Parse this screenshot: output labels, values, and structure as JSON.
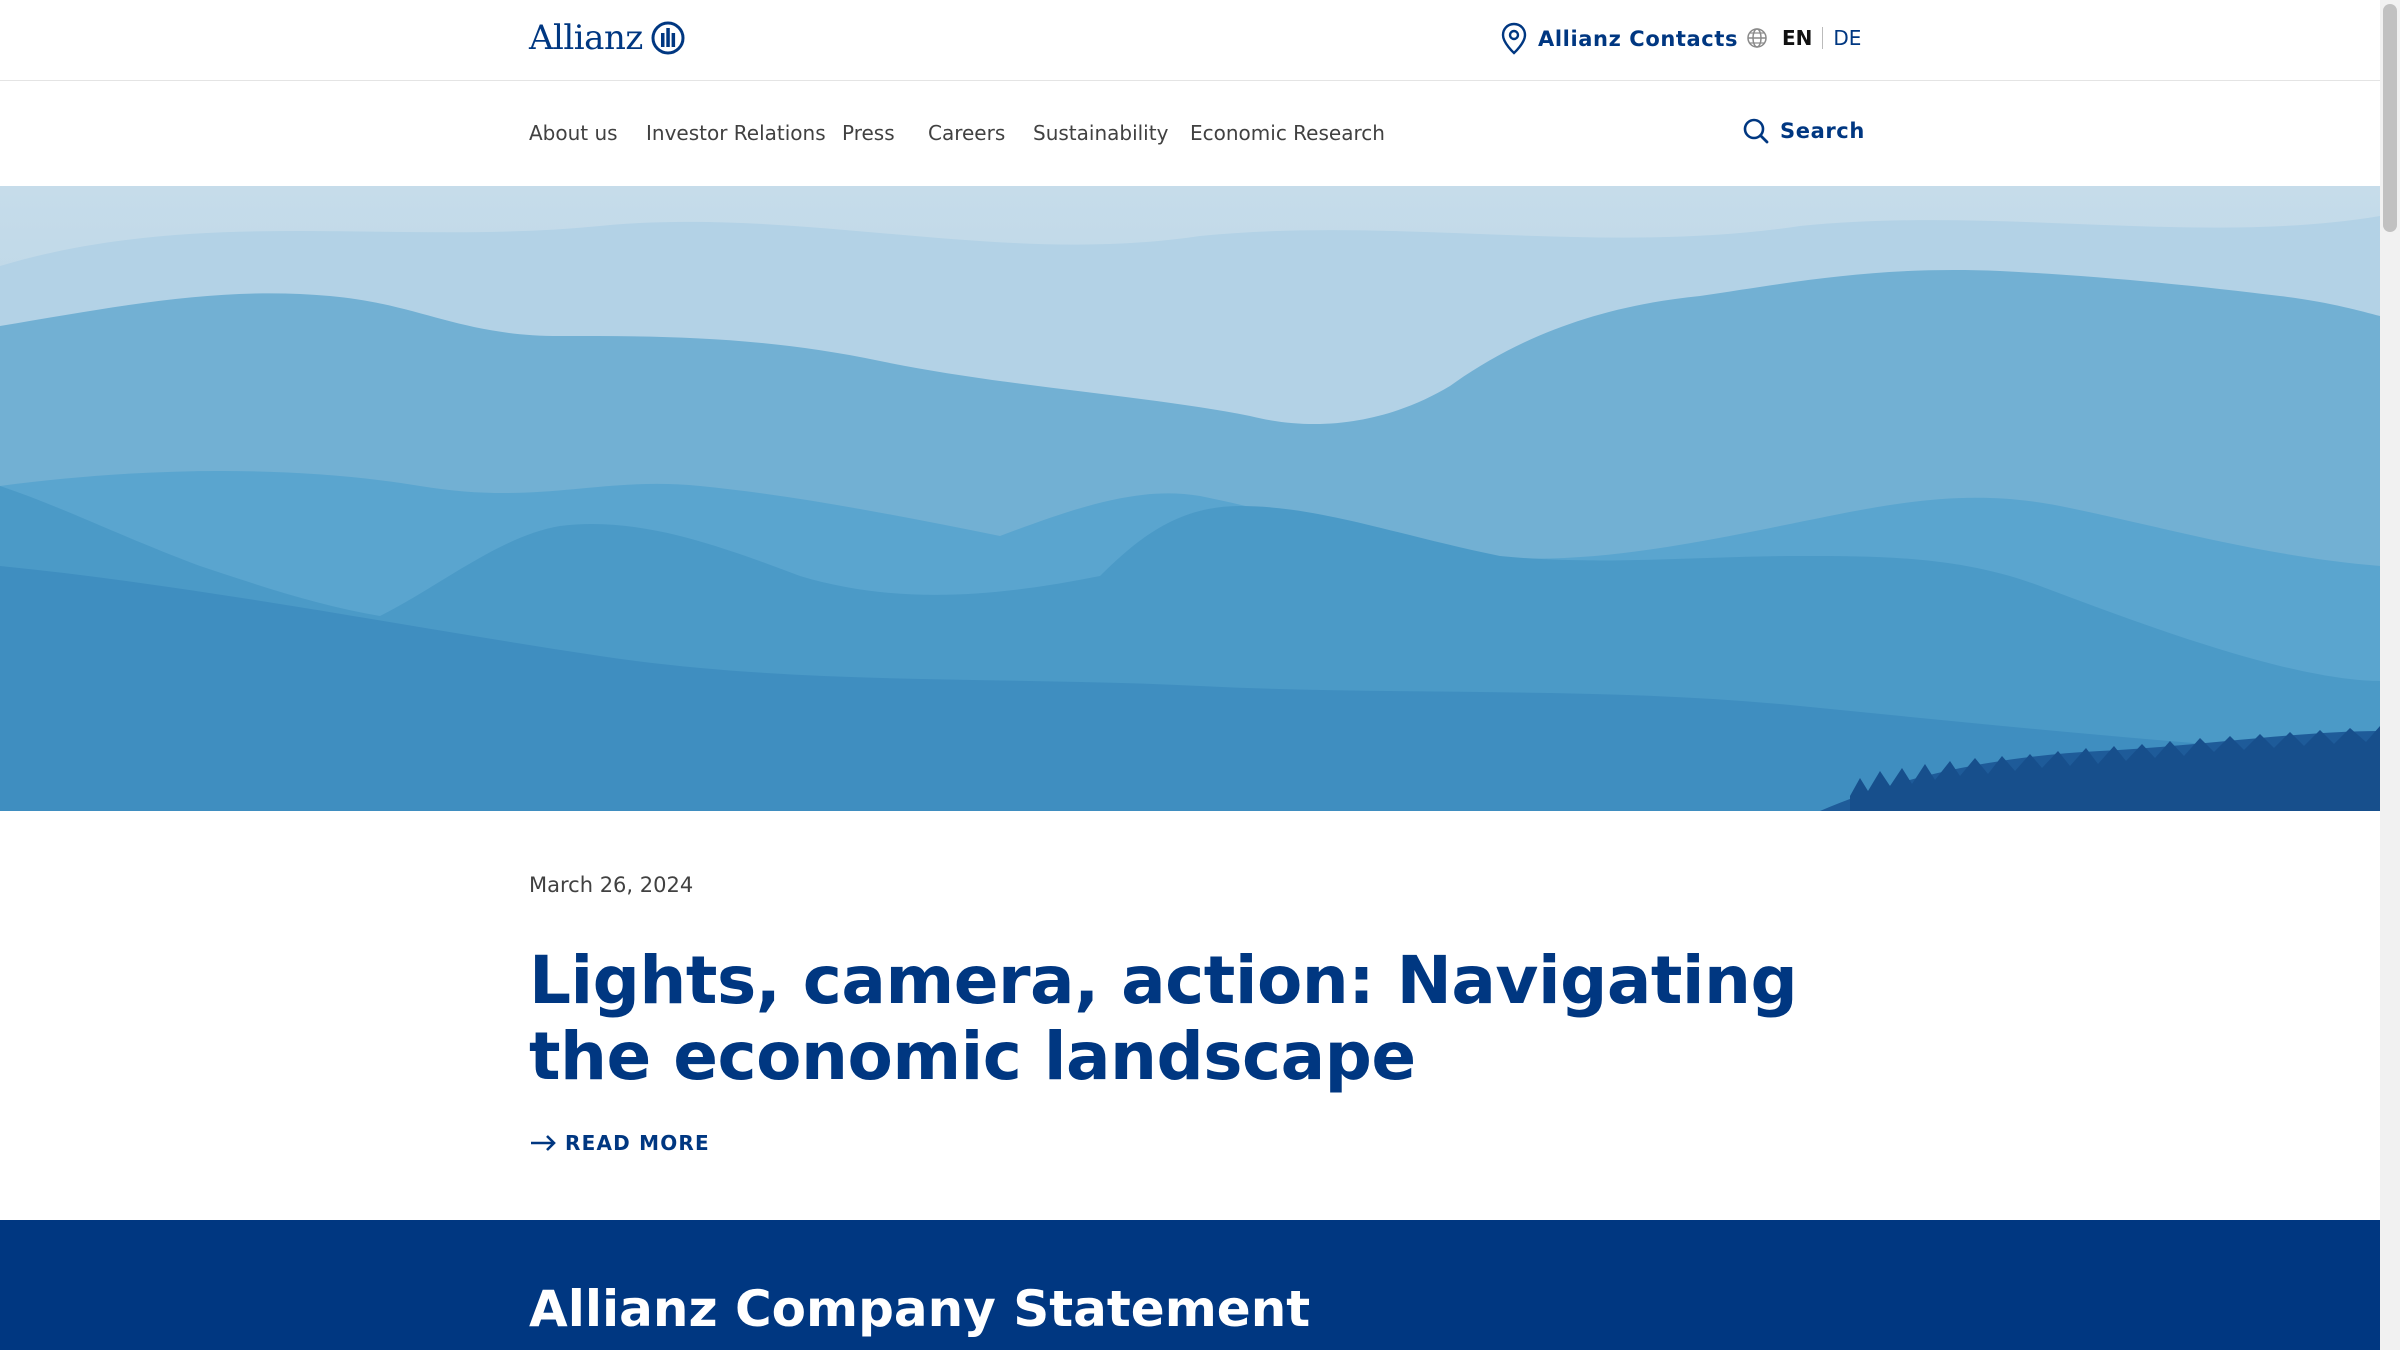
{
  "header": {
    "logo_text": "Allianz",
    "contacts_label": "Allianz Contacts",
    "lang_active": "EN",
    "lang_other": "DE"
  },
  "nav": {
    "items": [
      {
        "label": "About us"
      },
      {
        "label": "Investor Relations"
      },
      {
        "label": "Press"
      },
      {
        "label": "Careers"
      },
      {
        "label": "Sustainability"
      },
      {
        "label": "Economic Research"
      }
    ],
    "search_label": "Search"
  },
  "article": {
    "date": "March 26, 2024",
    "headline": "Lights, camera, action: Navigating the economic landscape",
    "read_more": "READ MORE"
  },
  "statement": {
    "title": "Allianz Company Statement"
  },
  "colors": {
    "brand": "#003781",
    "text_gray": "#414141",
    "sky": "#c6dcea"
  },
  "icons": [
    "logo-mark-icon",
    "location-pin-icon",
    "globe-icon",
    "search-icon",
    "arrow-right-icon"
  ]
}
